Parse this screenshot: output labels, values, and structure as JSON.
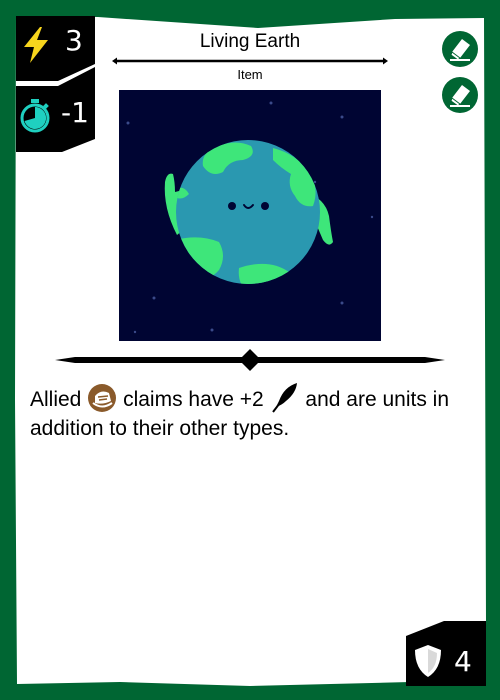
{
  "card": {
    "name": "Living Earth",
    "type": "Item",
    "cost": "3",
    "cost_icon": "lightning-icon",
    "speed": "-1",
    "speed_icon": "stopwatch-icon",
    "defense": "4",
    "defense_icon": "shield-icon",
    "rules": {
      "part1": "Allied",
      "claim_icon": "claim-icon",
      "part2": "claims have +2",
      "feather_icon": "feather-icon",
      "part3": "and are units in addition to their other types."
    },
    "badges": [
      "eraser-icon",
      "eraser-icon"
    ]
  },
  "colors": {
    "border": "#006633",
    "stat_box": "#000000",
    "art_background": "#000533",
    "planet_ocean": "#2a98b0",
    "planet_land": "#3ee67a",
    "timer": "#1fd0c0",
    "lightning": "#f7d51d",
    "claim": "#8a5a2b"
  }
}
